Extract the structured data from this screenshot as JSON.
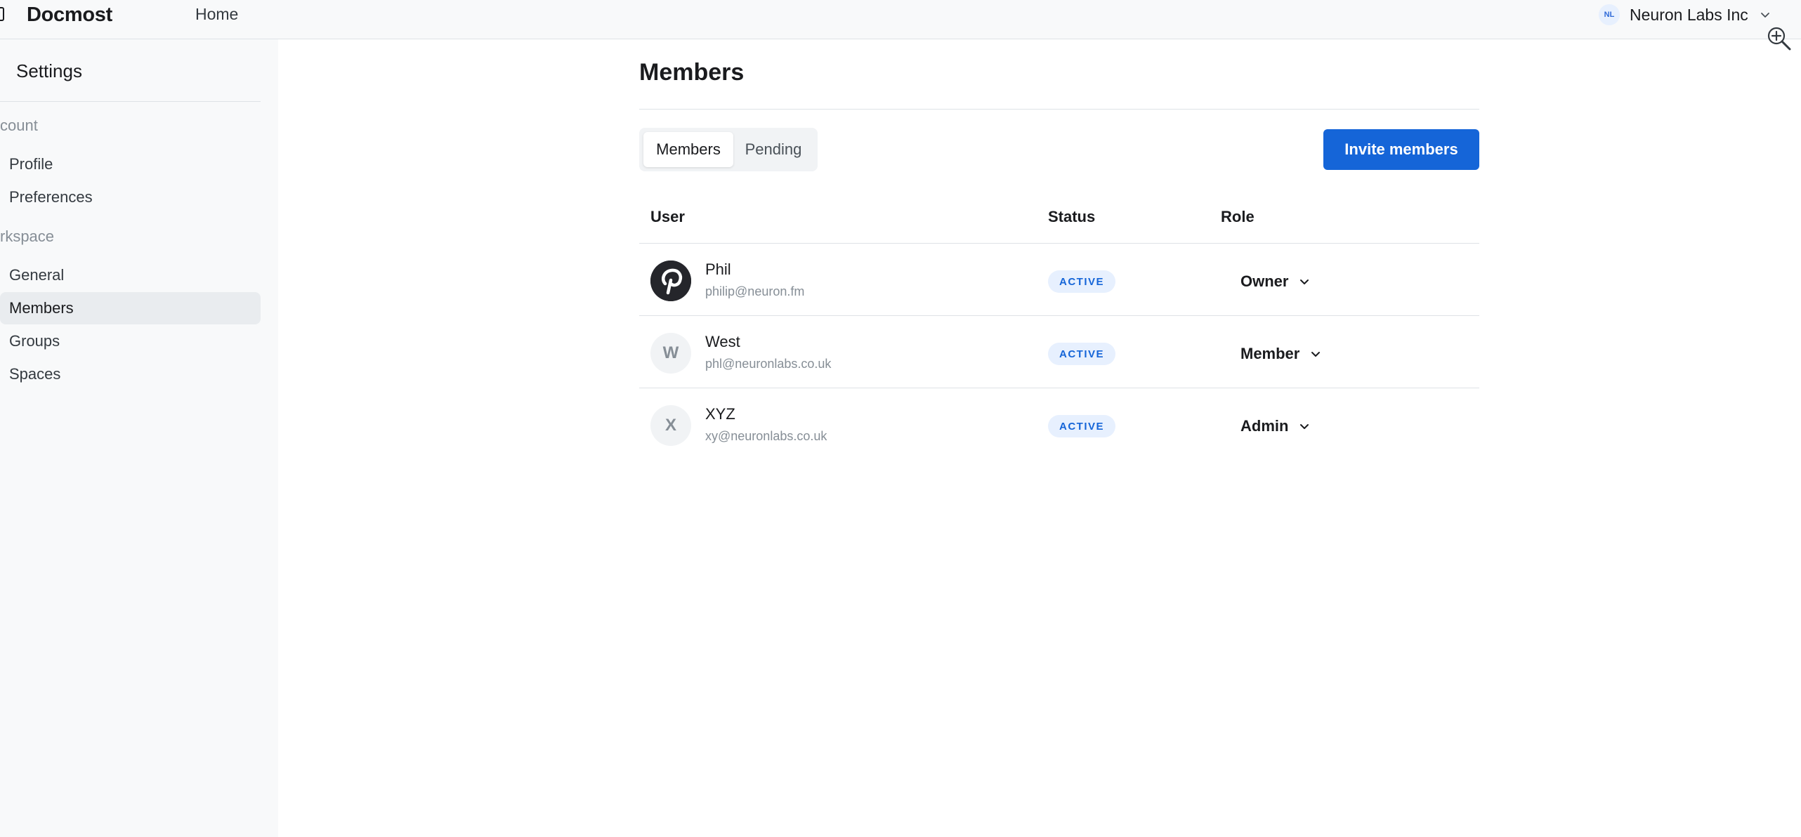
{
  "topbar": {
    "brand": "Docmost",
    "home_label": "Home",
    "workspace_initials": "NL",
    "workspace_name": "Neuron Labs Inc"
  },
  "sidebar": {
    "title": "Settings",
    "account_section": "count",
    "account_items": [
      "Profile",
      "Preferences"
    ],
    "workspace_section": "rkspace",
    "workspace_items": [
      "General",
      "Members",
      "Groups",
      "Spaces"
    ],
    "active_item": "Members"
  },
  "main": {
    "title": "Members",
    "tabs": [
      {
        "label": "Members",
        "active": true
      },
      {
        "label": "Pending",
        "active": false
      }
    ],
    "invite_button": "Invite members",
    "columns": {
      "user": "User",
      "status": "Status",
      "role": "Role"
    },
    "members": [
      {
        "name": "Phil",
        "email": "philip@neuron.fm",
        "avatar": "pinterest-logo",
        "status": "ACTIVE",
        "role": "Owner"
      },
      {
        "name": "West",
        "email": "phl@neuronlabs.co.uk",
        "avatar": "W",
        "status": "ACTIVE",
        "role": "Member"
      },
      {
        "name": "XYZ",
        "email": "xy@neuronlabs.co.uk",
        "avatar": "X",
        "status": "ACTIVE",
        "role": "Admin"
      }
    ]
  },
  "colors": {
    "primary": "#1565d8",
    "badge_bg": "#e7f0fe",
    "sidebar_bg": "#f8f9fa",
    "border": "#dee2e6"
  }
}
